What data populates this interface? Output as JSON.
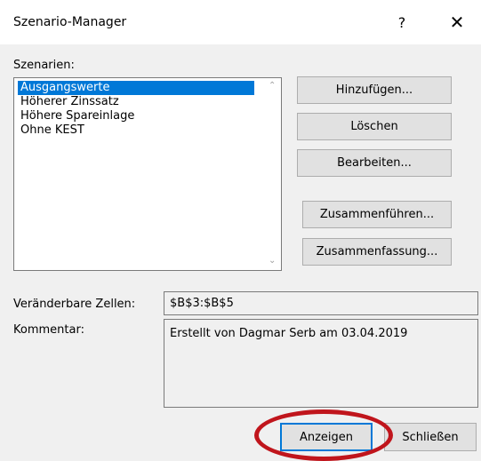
{
  "window": {
    "title": "Szenario-Manager",
    "help": "?",
    "close": "✕"
  },
  "scenarios": {
    "label": "Szenarien:",
    "items": [
      "Ausgangswerte",
      "Höherer Zinssatz",
      "Höhere Spareinlage",
      "Ohne KEST"
    ],
    "selected": "Ausgangswerte"
  },
  "buttons": {
    "add": "Hinzufügen...",
    "delete": "Löschen",
    "edit": "Bearbeiten...",
    "merge": "Zusammenführen...",
    "summary": "Zusammenfassung...",
    "show": "Anzeigen",
    "close": "Schließen"
  },
  "fields": {
    "changing_cells_label": "Veränderbare Zellen:",
    "changing_cells_value": "$B$3:$B$5",
    "comment_label": "Kommentar:",
    "comment_value": "Erstellt von Dagmar Serb am 03.04.2019"
  },
  "colors": {
    "selection": "#0078d7",
    "highlight_ring": "#c0151c"
  }
}
